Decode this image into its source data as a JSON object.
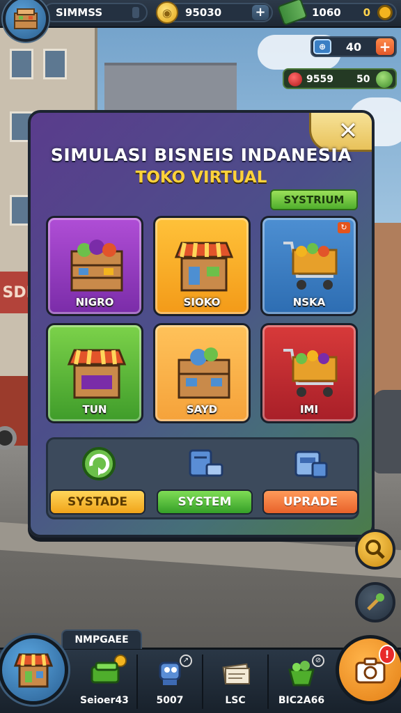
{
  "hud": {
    "player_name": "SIMMSS",
    "coins": "95030",
    "cash": "1060",
    "cash_extra": "0",
    "level_value": "40",
    "resource_1": "9559",
    "resource_2": "50"
  },
  "panel": {
    "title": "SIMULASI BISNEIS INDANESIA",
    "subtitle": "TOKO VIRTUAL",
    "top_button": "SYSTRIUM",
    "close": "✕",
    "tiles": [
      {
        "label": "NIGRO",
        "color": "#9b3ec6"
      },
      {
        "label": "SIOKO",
        "color": "#f7ac22"
      },
      {
        "label": "NSKA",
        "color": "#3d7ec2"
      },
      {
        "label": "TUN",
        "color": "#5eb83a"
      },
      {
        "label": "SAYD",
        "color": "#f8b040"
      },
      {
        "label": "IMI",
        "color": "#c52a30"
      }
    ],
    "actions": [
      {
        "label": "SYSTADE",
        "icon": "refresh-icon"
      },
      {
        "label": "SYSTEM",
        "icon": "server-icon"
      },
      {
        "label": "UPRADE",
        "icon": "box-icon"
      }
    ]
  },
  "bottombar": {
    "tab_label": "NMPGAEE",
    "items": [
      {
        "label": "Seioer43",
        "icon": "cash-stack-icon"
      },
      {
        "label": "5007",
        "icon": "robot-icon"
      },
      {
        "label": "LSC",
        "icon": "papers-icon"
      },
      {
        "label": "BIC2A66",
        "icon": "produce-basket-icon"
      }
    ],
    "notification_count": "!"
  }
}
